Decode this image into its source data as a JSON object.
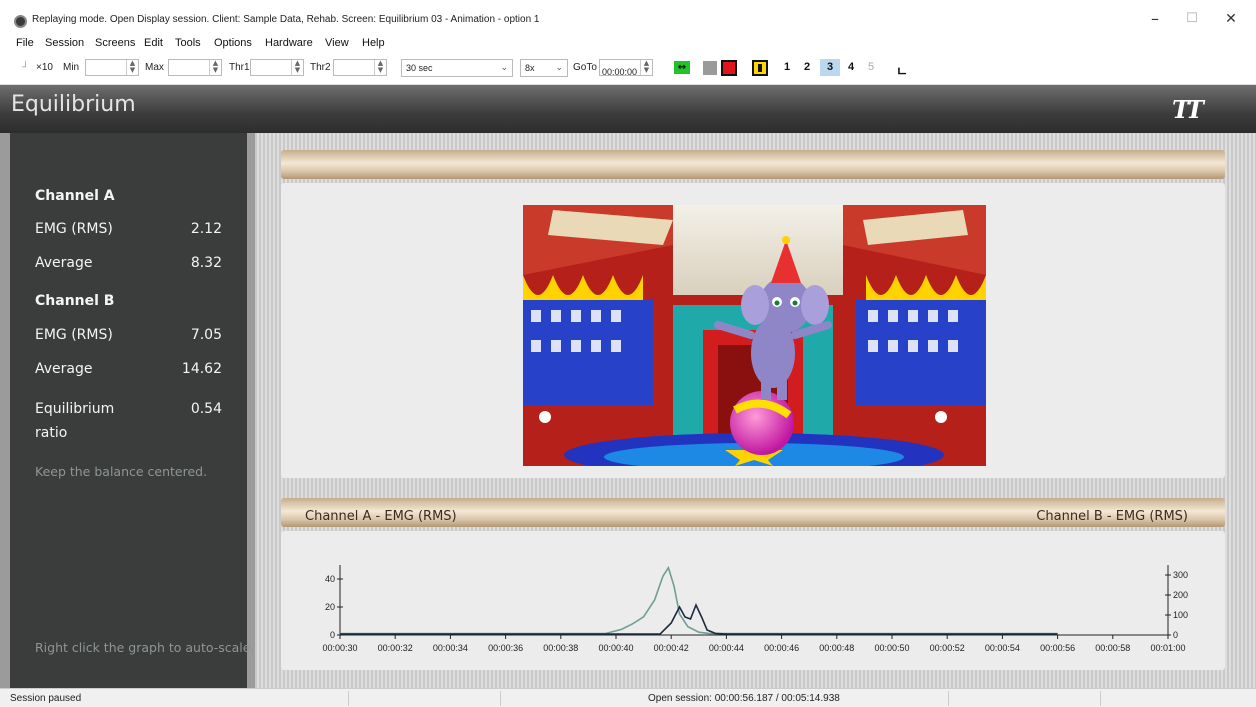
{
  "window": {
    "title": "Replaying mode. Open Display session. Client: Sample Data, Rehab. Screen: Equilibrium 03 - Animation - option 1",
    "minimize": "–",
    "maximize": "☐",
    "close": "✕"
  },
  "menu": [
    "File",
    "Session",
    "Screens",
    "Edit",
    "Tools",
    "Options",
    "Hardware",
    "View",
    "Help"
  ],
  "toolbar": {
    "x10": "×10",
    "min_label": "Min",
    "max_label": "Max",
    "thr1_label": "Thr1",
    "thr2_label": "Thr2",
    "duration": "30 sec",
    "speed": "8x",
    "goto_label": "GoTo",
    "goto_value": "00:00:00",
    "screens": [
      "1",
      "2",
      "3",
      "4",
      "5"
    ],
    "active_screen": "3"
  },
  "header": {
    "title": "Equilibrium",
    "logo": "TT"
  },
  "sidebar": {
    "channel_a": "Channel A",
    "emg_a_label": "EMG (RMS)",
    "emg_a_value": "2.12",
    "avg_a_label": "Average",
    "avg_a_value": "8.32",
    "channel_b": "Channel B",
    "emg_b_label": "EMG (RMS)",
    "emg_b_value": "7.05",
    "avg_b_label": "Average",
    "avg_b_value": "14.62",
    "ratio_label_1": "Equilibrium",
    "ratio_label_2": "ratio",
    "ratio_value": "0.54",
    "tip": "Keep the balance centered.",
    "autoscale_tip": "Right click the graph to auto-scale."
  },
  "graph": {
    "left_title": "Channel A - EMG (RMS)",
    "right_title": "Channel B - EMG (RMS)"
  },
  "chart_data": {
    "type": "line",
    "x_ticks": [
      "00:00:30",
      "00:00:32",
      "00:00:34",
      "00:00:36",
      "00:00:38",
      "00:00:40",
      "00:00:42",
      "00:00:44",
      "00:00:46",
      "00:00:48",
      "00:00:50",
      "00:00:52",
      "00:00:54",
      "00:00:56",
      "00:00:58",
      "00:01:00"
    ],
    "y_left_ticks": [
      "0",
      "20",
      "40"
    ],
    "y_right_ticks": [
      "0",
      "100",
      "200",
      "300"
    ],
    "ylim_left": [
      0,
      50
    ],
    "ylim_right": [
      0,
      350
    ],
    "series": [
      {
        "color": "#6f9f94",
        "axis": "left",
        "x": [
          30,
          39.6,
          40.2,
          40.6,
          41.0,
          41.4,
          41.7,
          41.9,
          42.1,
          42.3,
          42.6,
          43.0,
          43.4,
          44.0,
          56
        ],
        "y": [
          1,
          1,
          4,
          8,
          13,
          25,
          42,
          48,
          35,
          15,
          6,
          2,
          1,
          1,
          1
        ]
      },
      {
        "color": "#1b2a3c",
        "axis": "right",
        "x": [
          30,
          41.6,
          42.0,
          42.3,
          42.5,
          42.7,
          42.9,
          43.1,
          43.3,
          43.6,
          44.0,
          56
        ],
        "y": [
          5,
          5,
          60,
          140,
          90,
          80,
          150,
          90,
          25,
          8,
          5,
          5
        ]
      }
    ]
  },
  "status": {
    "left": "Session paused",
    "center": "Open session: 00:00:56.187 / 00:05:14.938"
  },
  "colors": {
    "header_bg": "#3c3c3c",
    "sidebar_bg": "#3b3d3d",
    "gold": "#e8d6bd",
    "panel": "#ececec"
  }
}
